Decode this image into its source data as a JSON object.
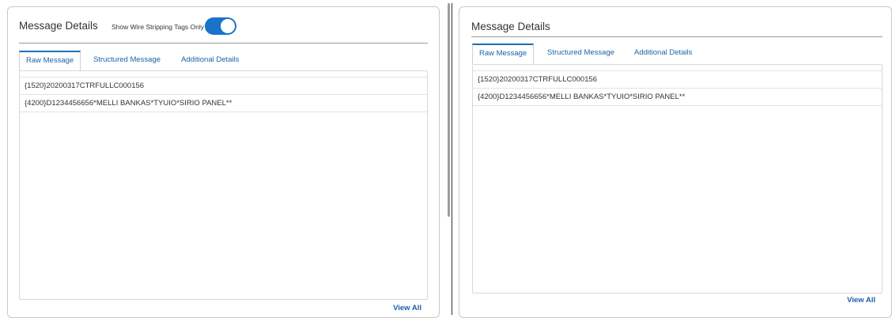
{
  "left_panel": {
    "title": "Message Details",
    "toggle_label": "Show Wire Stripping Tags Only",
    "toggle_on": true,
    "tabs": [
      {
        "label": "Raw Message",
        "active": true
      },
      {
        "label": "Structured Message",
        "active": false
      },
      {
        "label": "Additional Details",
        "active": false
      }
    ],
    "lines": [
      "{1520}20200317CTRFULLC000156",
      "{4200}D1234456656*MELLI BANKAS*TYUIO*SIRIO PANEL**"
    ],
    "view_all": "View All"
  },
  "right_panel": {
    "title": "Message Details",
    "tabs": [
      {
        "label": "Raw Message",
        "active": true
      },
      {
        "label": "Structured Message",
        "active": false
      },
      {
        "label": "Additional Details",
        "active": false
      }
    ],
    "lines": [
      "{1520}20200317CTRFULLC000156",
      "{4200}D1234456656*MELLI BANKAS*TYUIO*SIRIO PANEL**"
    ],
    "view_all": "View All"
  },
  "colors": {
    "accent": "#1a73c9",
    "link": "#1a63a8"
  }
}
